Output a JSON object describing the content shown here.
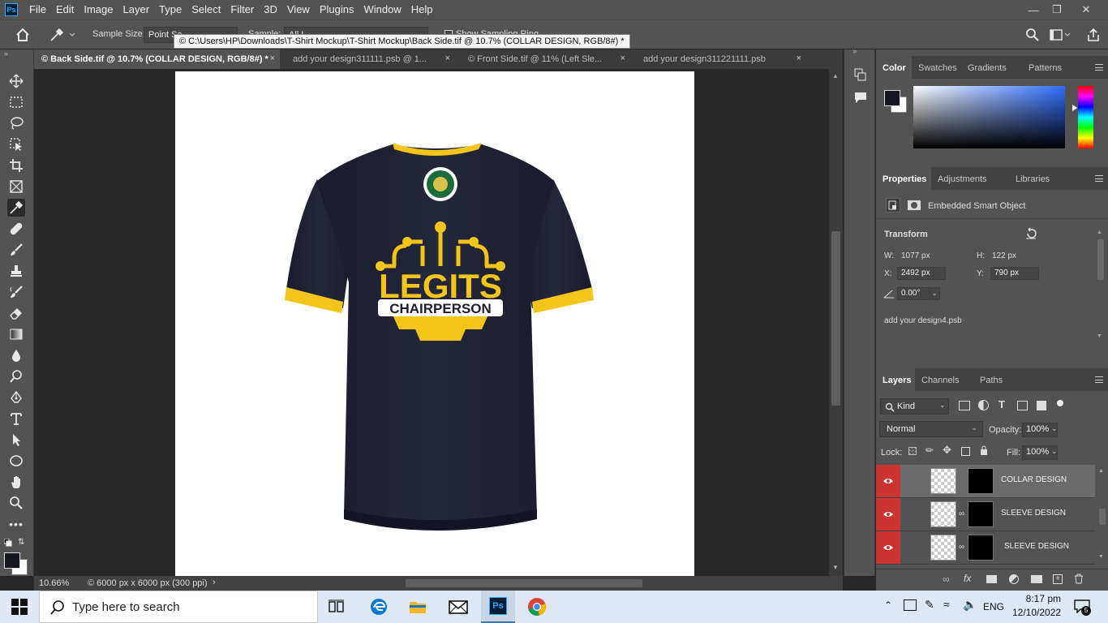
{
  "menubar": {
    "logo": "Ps",
    "items": [
      "File",
      "Edit",
      "Image",
      "Layer",
      "Type",
      "Select",
      "Filter",
      "3D",
      "View",
      "Plugins",
      "Window",
      "Help"
    ],
    "controls": [
      "minimize",
      "restore",
      "close"
    ]
  },
  "options_bar": {
    "sample_size_label": "Sample Size:",
    "sample_size_value": "Point Sa",
    "sample_label": "Sample:",
    "sample_value": "All L",
    "show_sampling_ring": "Show Sampling Ring"
  },
  "tooltip": "© C:\\Users\\HP\\Downloads\\T-Shirt Mockup\\T-Shirt Mockup\\Back Side.tif @ 10.7% (COLLAR DESIGN, RGB/8#) *",
  "doc_tabs": [
    {
      "label": "© Back Side.tif @ 10.7% (COLLAR DESIGN, RGB/8#) *",
      "close": "×"
    },
    {
      "label": "add your design311111.psb @ 1...",
      "close": "×"
    },
    {
      "label": "© Front Side.tif @ 11% (Left Sle...",
      "close": "×"
    },
    {
      "label": "add your design311221111.psb",
      "close": "×"
    }
  ],
  "artwork": {
    "logo_main": "LEGITS",
    "logo_sub": "CHAIRPERSON"
  },
  "status_bar": {
    "zoom": "10.66%",
    "doc_info": "© 6000 px x 6000 px (300 ppi)",
    "arrow": "›"
  },
  "color_panel": {
    "tabs": [
      "Color",
      "Swatches",
      "Gradients",
      "Patterns"
    ]
  },
  "properties_panel": {
    "tabs": [
      "Properties",
      "Adjustments",
      "Libraries"
    ],
    "object_type": "Embedded Smart Object",
    "transform_label": "Transform",
    "w_label": "W:",
    "w_value": "1077 px",
    "h_label": "H:",
    "h_value": "122 px",
    "x_label": "X:",
    "x_value": "2492 px",
    "y_label": "Y:",
    "y_value": "790 px",
    "angle_value": "0.00°",
    "linked_file": "add your design4.psb"
  },
  "layers_panel": {
    "tabs": [
      "Layers",
      "Channels",
      "Paths"
    ],
    "kind_label": "Kind",
    "blend_mode": "Normal",
    "opacity_label": "Opacity:",
    "opacity_value": "100%",
    "lock_label": "Lock:",
    "fill_label": "Fill:",
    "fill_value": "100%",
    "layers": [
      {
        "name": "COLLAR DESIGN"
      },
      {
        "name": "SLEEVE DESIGN"
      },
      {
        "name": "SLEEVE DESIGN"
      }
    ],
    "footer_icons": [
      "link-icon",
      "fx-icon",
      "mask-icon",
      "adjustment-icon",
      "folder-icon",
      "new-layer-icon",
      "trash-icon"
    ]
  },
  "taskbar": {
    "search_placeholder": "Type here to search",
    "language": "ENG",
    "time": "8:17 pm",
    "date": "12/10/2022",
    "notifications": "5",
    "apps": [
      "task-view",
      "edge",
      "file-explorer",
      "mail",
      "photoshop",
      "chrome"
    ]
  },
  "colors": {
    "ui_dark": "#535353",
    "canvas_bg": "#282828",
    "shirt": "#222336",
    "trim_yellow": "#f3c51a",
    "layer_eye_red": "#c83232"
  }
}
